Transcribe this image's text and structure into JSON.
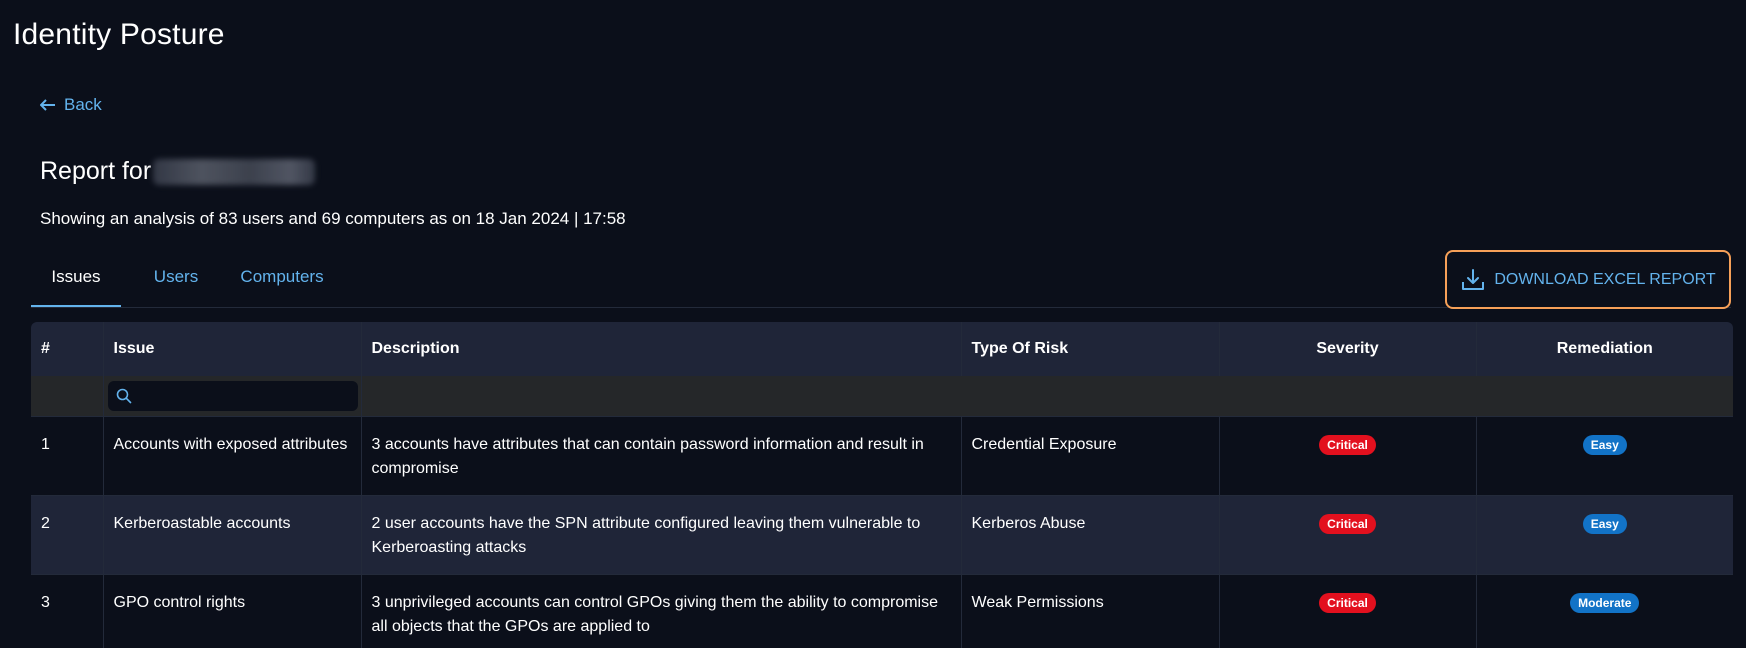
{
  "page": {
    "title": "Identity Posture",
    "back_label": "Back",
    "report_prefix": "Report for",
    "summary": "Showing an analysis of 83 users and 69 computers as on 18 Jan 2024 | 17:58"
  },
  "tabs": [
    {
      "label": "Issues",
      "active": true
    },
    {
      "label": "Users",
      "active": false
    },
    {
      "label": "Computers",
      "active": false
    }
  ],
  "download": {
    "label": "DOWNLOAD EXCEL REPORT",
    "icon": "download-icon"
  },
  "table": {
    "columns": [
      "#",
      "Issue",
      "Description",
      "Type Of Risk",
      "Severity",
      "Remediation"
    ],
    "search": {
      "placeholder": "",
      "value": "",
      "icon": "search-icon"
    },
    "rows": [
      {
        "index": "1",
        "issue": "Accounts with exposed attributes",
        "description": "3 accounts have attributes that can contain password information and result in compromise",
        "risk_type": "Credential Exposure",
        "severity": "Critical",
        "remediation": "Easy"
      },
      {
        "index": "2",
        "issue": "Kerberoastable accounts",
        "description": "2 user accounts have the SPN attribute configured leaving them vulnerable to Kerberoasting attacks",
        "risk_type": "Kerberos Abuse",
        "severity": "Critical",
        "remediation": "Easy"
      },
      {
        "index": "3",
        "issue": "GPO control rights",
        "description": "3 unprivileged accounts can control GPOs giving them the ability to compromise all objects that the GPOs are applied to",
        "risk_type": "Weak Permissions",
        "severity": "Critical",
        "remediation": "Moderate"
      }
    ]
  },
  "colors": {
    "background": "#0b0f1a",
    "header_bg": "#1f2538",
    "accent": "#63b3ed",
    "highlight_border": "#f6a058",
    "critical": "#e3101e",
    "easy": "#1273c7",
    "moderate": "#1273c7"
  }
}
